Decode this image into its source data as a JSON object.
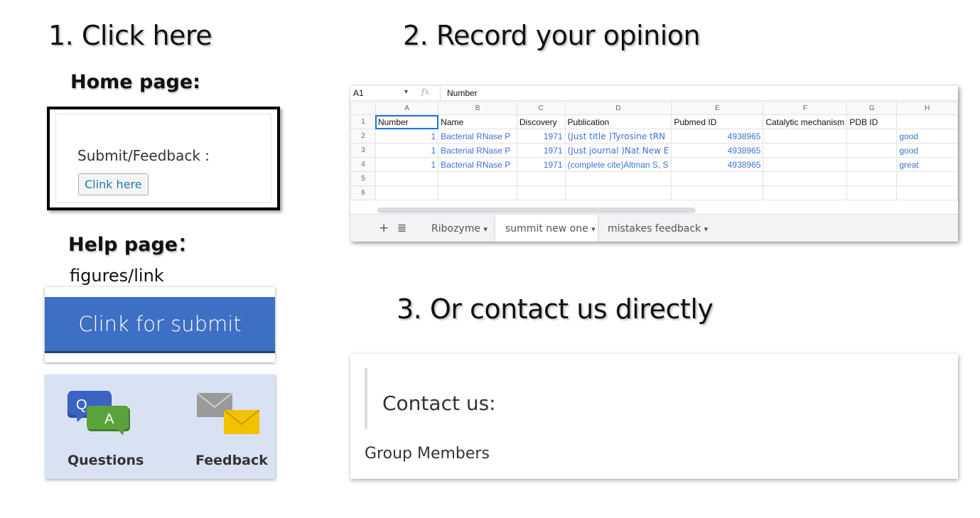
{
  "steps": {
    "step1": "1. Click here",
    "step2": "2. Record your opinion",
    "step3": "3. Or contact us directly"
  },
  "home_page": {
    "heading": "Home page:",
    "label": "Submit/Feedback :",
    "button": "Clink here"
  },
  "help_page": {
    "heading": "Help page：",
    "link_text": "figures/link",
    "submit_banner": "Clink for submit",
    "questions_label": "Questions",
    "feedback_label": "Feedback",
    "qa_q": "Q",
    "qa_a": "A",
    "colors": {
      "banner": "#3d70c4",
      "panel": "#d9e2f3",
      "q_bubble": "#3b63c4",
      "a_bubble": "#5aa33c",
      "envelope_back": "#9a9a9a",
      "envelope_front": "#f2c200"
    }
  },
  "spreadsheet": {
    "cell_ref": "A1",
    "fx": "fx",
    "formula_value": "Number",
    "col_letters": [
      "A",
      "B",
      "C",
      "D",
      "E",
      "F",
      "G",
      "H"
    ],
    "row_numbers": [
      "1",
      "2",
      "3",
      "4",
      "5",
      "6"
    ],
    "header_row": [
      "Number",
      "Name",
      "Discovery",
      "Publication",
      "Pubmed ID",
      "Catalytic mechanism",
      "PDB ID",
      ""
    ],
    "rows": [
      [
        "1",
        "Bacterial RNase P",
        "1971",
        "(Just title )Tyrosine tRN",
        "4938965",
        "",
        "",
        "good"
      ],
      [
        "1",
        "Bacterial RNase P",
        "1971",
        "(Just journal )Nat New E",
        "4938965",
        "",
        "",
        "good"
      ],
      [
        "1",
        "Bacterial RNase P",
        "1971",
        "(complete cite)Altman S, S",
        "4938965",
        "",
        "",
        "great"
      ]
    ],
    "tabs": {
      "add": "+",
      "menu": "≣",
      "tab1": "Ribozyme",
      "tab2": "summit new one",
      "tab3": "mistakes feedback",
      "caret": "▾"
    },
    "colors": {
      "link_blue": "#3d72d8",
      "active_tab": "#188038",
      "selection": "#1a73e8"
    }
  },
  "contact": {
    "title": "Contact us:",
    "members": "Group Members"
  }
}
